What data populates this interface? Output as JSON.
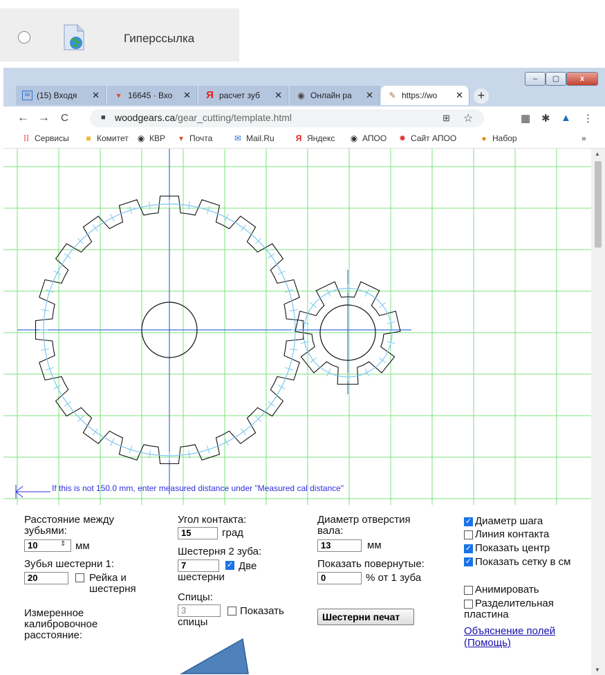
{
  "hyperlink_option": {
    "label": "Гиперссылка"
  },
  "window": {
    "controls": [
      "–",
      "▢",
      "x"
    ]
  },
  "tabs": [
    {
      "label": "(15) Входя",
      "icon": "mail-icon",
      "color": "#2b70d9"
    },
    {
      "label": "16645 · Вхо",
      "icon": "yandex-mail-icon",
      "color": "#e04a2a"
    },
    {
      "label": "расчет зуб",
      "icon": "yandex-icon",
      "color": "#e5211d"
    },
    {
      "label": "Онлайн ра",
      "icon": "globe-icon",
      "color": "#444"
    },
    {
      "label": "https://wo",
      "icon": "woodgears-icon",
      "color": "#b36b2c"
    }
  ],
  "toolbar": {
    "back": "←",
    "forward": "→",
    "reload": "C",
    "url_host": "woodgears.ca",
    "url_path": "/gear_cutting/template.html"
  },
  "bookmarks": [
    {
      "label": "Сервисы",
      "icon": "apps-icon"
    },
    {
      "label": "Комитет",
      "icon": "folder-icon"
    },
    {
      "label": "КВР",
      "icon": "globe-icon"
    },
    {
      "label": "Почта",
      "icon": "mail-icon"
    },
    {
      "label": "Mail.Ru",
      "icon": "mailru-icon"
    },
    {
      "label": "Яндекс",
      "icon": "yandex-icon"
    },
    {
      "label": "АПОО",
      "icon": "globe-icon"
    },
    {
      "label": "Сайт АПОО",
      "icon": "site-icon"
    },
    {
      "label": "Набор",
      "icon": "nabor-icon"
    }
  ],
  "bookmarks_more": "»",
  "calibration_text": "If this is not 150.0 mm, enter measured distance under \"Measured cal distance\"",
  "gear1": {
    "teeth": 20
  },
  "gear2": {
    "teeth": 7
  },
  "form": {
    "tooth_spacing_label": "Расстояние между зубьями:",
    "tooth_spacing_value": "10",
    "tooth_spacing_unit": "мм",
    "gear1_teeth_label": "Зубья шестерни 1:",
    "gear1_teeth_value": "20",
    "rack_label": "Рейка и шестерня",
    "measured_cal_label": "Измеренное калибровочное расстояние:",
    "contact_angle_label": "Угол контакта:",
    "contact_angle_value": "15",
    "contact_angle_unit": "град",
    "gear2_teeth_label": "Шестерня 2 зуба:",
    "gear2_teeth_value": "7",
    "two_gears_label": "Две шестерни",
    "spokes_label": "Спицы:",
    "spokes_value": "3",
    "show_spokes_label": "Показать спицы",
    "shaft_diameter_label": "Диаметр отверстия вала:",
    "shaft_diameter_value": "13",
    "shaft_diameter_unit": "мм",
    "show_rotated_label": "Показать повернутые:",
    "show_rotated_value": "0",
    "show_rotated_unit": "% от 1 зуба",
    "print_button": "Шестерни печат",
    "pitch_diameter": "Диаметр шага",
    "contact_line": "Линия контакта",
    "show_center": "Показать центр",
    "show_grid": "Показать сетку в см",
    "animate": "Анимировать",
    "separator_plate": "Разделительная пластина",
    "explain_link": "Объяснение полей",
    "help_link": "(Помощь)"
  },
  "checks": {
    "pitch_diameter": true,
    "contact_line": false,
    "show_center": true,
    "show_grid": true,
    "animate": false,
    "separator_plate": false,
    "rack": false,
    "two_gears": true,
    "show_spokes": false
  }
}
